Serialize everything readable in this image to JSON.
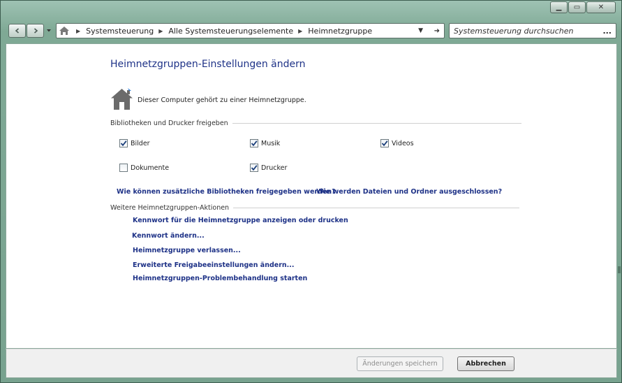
{
  "window": {
    "caption": {
      "minimize": "▁",
      "maximize": "▭",
      "close": "✕"
    }
  },
  "nav": {
    "back_icon": "back-arrow-icon",
    "forward_icon": "forward-arrow-icon",
    "history_dropdown_icon": "chevron-down-icon"
  },
  "address": {
    "breadcrumbs": [
      "Systemsteuerung",
      "Alle Systemsteuerungselemente",
      "Heimnetzgruppe"
    ]
  },
  "search": {
    "placeholder": "Systemsteuerung durchsuchen",
    "more": "..."
  },
  "page": {
    "title": "Heimnetzgruppen-Einstellungen ändern",
    "status": "Dieser Computer gehört zu einer Heimnetzgruppe.",
    "share_section": "Bibliotheken und Drucker freigeben",
    "checkboxes": [
      {
        "label": "Bilder",
        "checked": true
      },
      {
        "label": "Musik",
        "checked": true
      },
      {
        "label": "Videos",
        "checked": true
      },
      {
        "label": "Dokumente",
        "checked": false
      },
      {
        "label": "Drucker",
        "checked": true
      }
    ],
    "links": {
      "more_libraries": "Wie können zusätzliche Bibliotheken freigegeben werden?",
      "exclude": "Wie werden Dateien und Ordner ausgeschlossen?"
    },
    "actions_section": "Weitere Heimnetzgruppen-Aktionen",
    "actions": [
      "Kennwort für die Heimnetzgruppe anzeigen oder drucken",
      "Kennwort ändern...",
      "Heimnetzgruppe verlassen...",
      "Erweiterte Freigabeeinstellungen ändern...",
      "Heimnetzgruppen-Problembehandlung starten"
    ]
  },
  "footer": {
    "save": "Änderungen speichern",
    "cancel": "Abbrechen"
  },
  "colors": {
    "link": "#1e3287",
    "frame": "#78a28f",
    "house_icon": "#6b6b6b"
  }
}
